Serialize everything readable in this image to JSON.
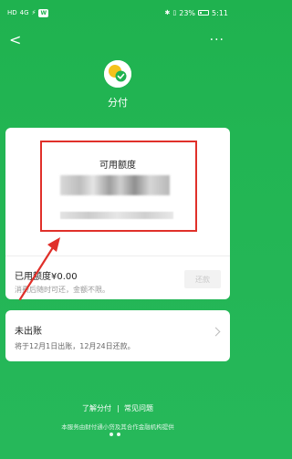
{
  "status_bar": {
    "left_items": [
      "HD",
      "4G",
      "⚡"
    ],
    "battery": "23%",
    "time": "5:11"
  },
  "nav": {
    "back": "<",
    "more": "···"
  },
  "brand": {
    "name": "分付"
  },
  "quota_card": {
    "title": "可用额度",
    "used_label": "已用额度¥0.00",
    "note": "消费后随时可还，金额不限。",
    "repay_button": "还款"
  },
  "bill_card": {
    "title": "未出账",
    "note": "将于12月1日出账，12月24日还款。"
  },
  "footer": {
    "link_1": "了解分付",
    "link_2": "常见问题",
    "note": "本服务由财付通小贷及其合作金融机构提供"
  },
  "colors": {
    "background": "#22b553",
    "highlight": "#e0302a",
    "logo_yellow": "#f4c21c",
    "logo_green": "#1fb24f"
  }
}
